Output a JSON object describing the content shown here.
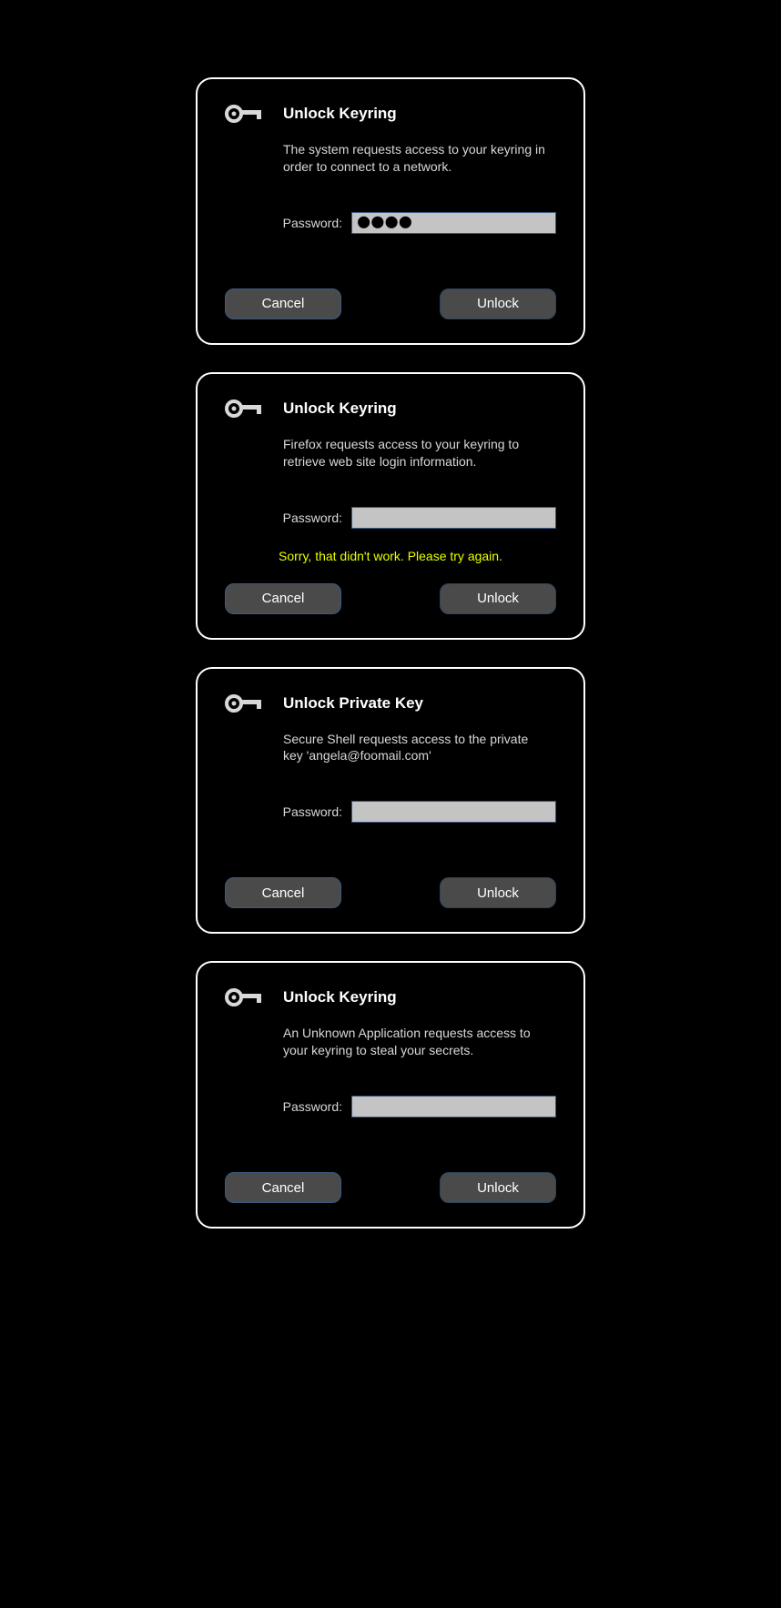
{
  "dialogs": [
    {
      "title": "Unlock Keyring",
      "description": "The system requests access to your keyring in order to connect to a network.",
      "password_label": "Password:",
      "password_value": "●●●●",
      "has_dots": true,
      "error": "",
      "cancel_label": "Cancel",
      "unlock_label": "Unlock"
    },
    {
      "title": "Unlock Keyring",
      "description": "Firefox requests access to your keyring to retrieve web site login information.",
      "password_label": "Password:",
      "password_value": "",
      "has_dots": false,
      "error": "Sorry, that didn't work.  Please try again.",
      "cancel_label": "Cancel",
      "unlock_label": "Unlock"
    },
    {
      "title": "Unlock Private Key",
      "description": "Secure Shell requests access to the private key 'angela@foomail.com'",
      "password_label": "Password:",
      "password_value": "",
      "has_dots": false,
      "error": "",
      "cancel_label": "Cancel",
      "unlock_label": "Unlock"
    },
    {
      "title": "Unlock Keyring",
      "description": "An Unknown Application requests access to your keyring to steal your secrets.",
      "password_label": "Password:",
      "password_value": "",
      "has_dots": false,
      "error": "",
      "cancel_label": "Cancel",
      "unlock_label": "Unlock"
    }
  ]
}
